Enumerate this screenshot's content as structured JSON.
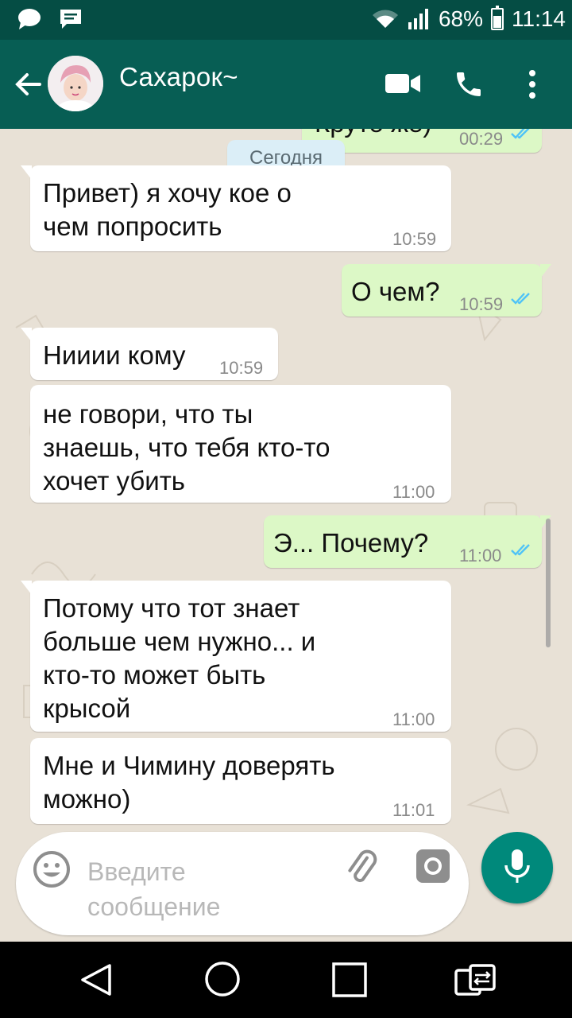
{
  "status_bar": {
    "battery": "68%",
    "time": "11:14",
    "icons": [
      "chat-bubble-icon",
      "message-icon",
      "wifi-icon",
      "signal-icon",
      "battery-icon"
    ]
  },
  "header": {
    "contact_name": "Сахарок~",
    "icons": [
      "back-arrow-icon",
      "avatar",
      "video-call-icon",
      "phone-icon",
      "more-vert-icon"
    ]
  },
  "chat": {
    "partial_top": {
      "text": "Круто же)",
      "time": "00:29"
    },
    "date_label": "Сегодня",
    "messages": [
      {
        "dir": "in",
        "lines": [
          "Привет) я хочу кое о",
          "чем попросить"
        ],
        "time": "10:59"
      },
      {
        "dir": "out",
        "lines": [
          "О чем?"
        ],
        "time": "10:59"
      },
      {
        "dir": "in",
        "lines": [
          "Нииии кому"
        ],
        "time": "10:59"
      },
      {
        "dir": "in",
        "lines": [
          "не говори, что ты",
          "знаешь, что тебя кто-то",
          "хочет убить"
        ],
        "time": "11:00"
      },
      {
        "dir": "out",
        "lines": [
          "Э... Почему?"
        ],
        "time": "11:00"
      },
      {
        "dir": "in",
        "lines": [
          "Потому что тот знает",
          "больше чем нужно... и",
          "кто-то может быть",
          "крысой"
        ],
        "time": "11:00"
      },
      {
        "dir": "in",
        "lines": [
          "Мне и Чимину доверять",
          "можно)"
        ],
        "time": "11:01"
      }
    ]
  },
  "input": {
    "placeholder_line1": "Введите",
    "placeholder_line2": "сообщение",
    "icons": [
      "emoji-icon",
      "attach-icon",
      "camera-icon",
      "mic-icon"
    ]
  },
  "colors": {
    "header": "#075e54",
    "status_bar": "#054d44",
    "incoming": "#ffffff",
    "outgoing": "#dcf8c6",
    "tick": "#4fc3f7",
    "mic": "#00897b"
  },
  "navbar": {
    "icons": [
      "nav-back-icon",
      "nav-home-icon",
      "nav-recents-icon",
      "nav-switch-icon"
    ]
  }
}
